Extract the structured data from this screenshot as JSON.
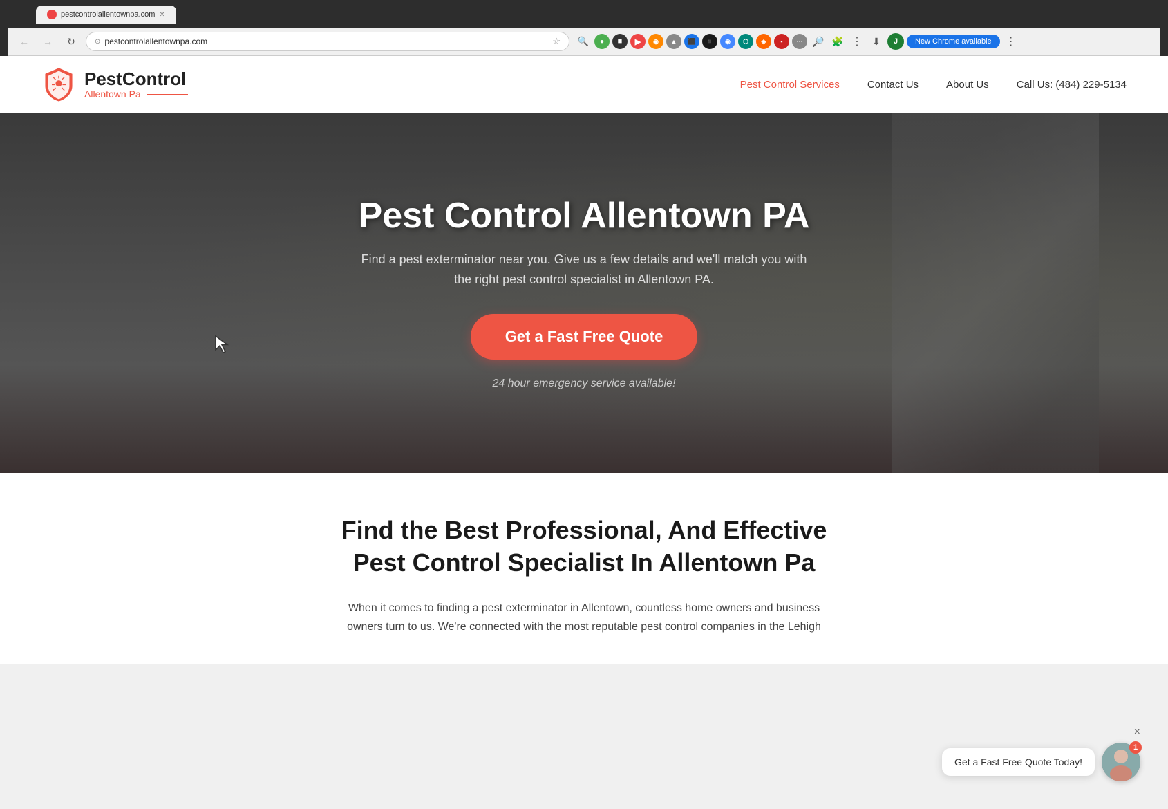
{
  "browser": {
    "tab_title": "pestcontrolallentownpa.com",
    "url": "pestcontrolallentownpa.com",
    "new_chrome_label": "New Chrome available"
  },
  "header": {
    "logo_title": "PestControl",
    "logo_subtitle": "Allentown Pa",
    "nav_items": [
      {
        "label": "Pest Control Services",
        "active": true
      },
      {
        "label": "Contact Us",
        "active": false
      },
      {
        "label": "About Us",
        "active": false
      }
    ],
    "phone": "Call Us: (484) 229-5134"
  },
  "hero": {
    "title": "Pest Control Allentown PA",
    "subtitle_line1": "Find a pest exterminator near you. Give us a few details and we'll match you with",
    "subtitle_line2": "the right pest control specialist in Allentown PA.",
    "cta_button": "Get a Fast Free Quote",
    "emergency_text": "24 hour emergency service available!"
  },
  "below_hero": {
    "title_line1": "Find the Best Professional, And Effective",
    "title_line2": "Pest Control Specialist In Allentown Pa",
    "body_text": "When it comes to finding a pest exterminator in Allentown, countless home owners and business owners turn to us. We're connected with the most reputable pest control companies in the Lehigh"
  },
  "chat_widget": {
    "message": "Get a Fast Free Quote Today!",
    "badge_count": "1",
    "close_label": "×"
  }
}
